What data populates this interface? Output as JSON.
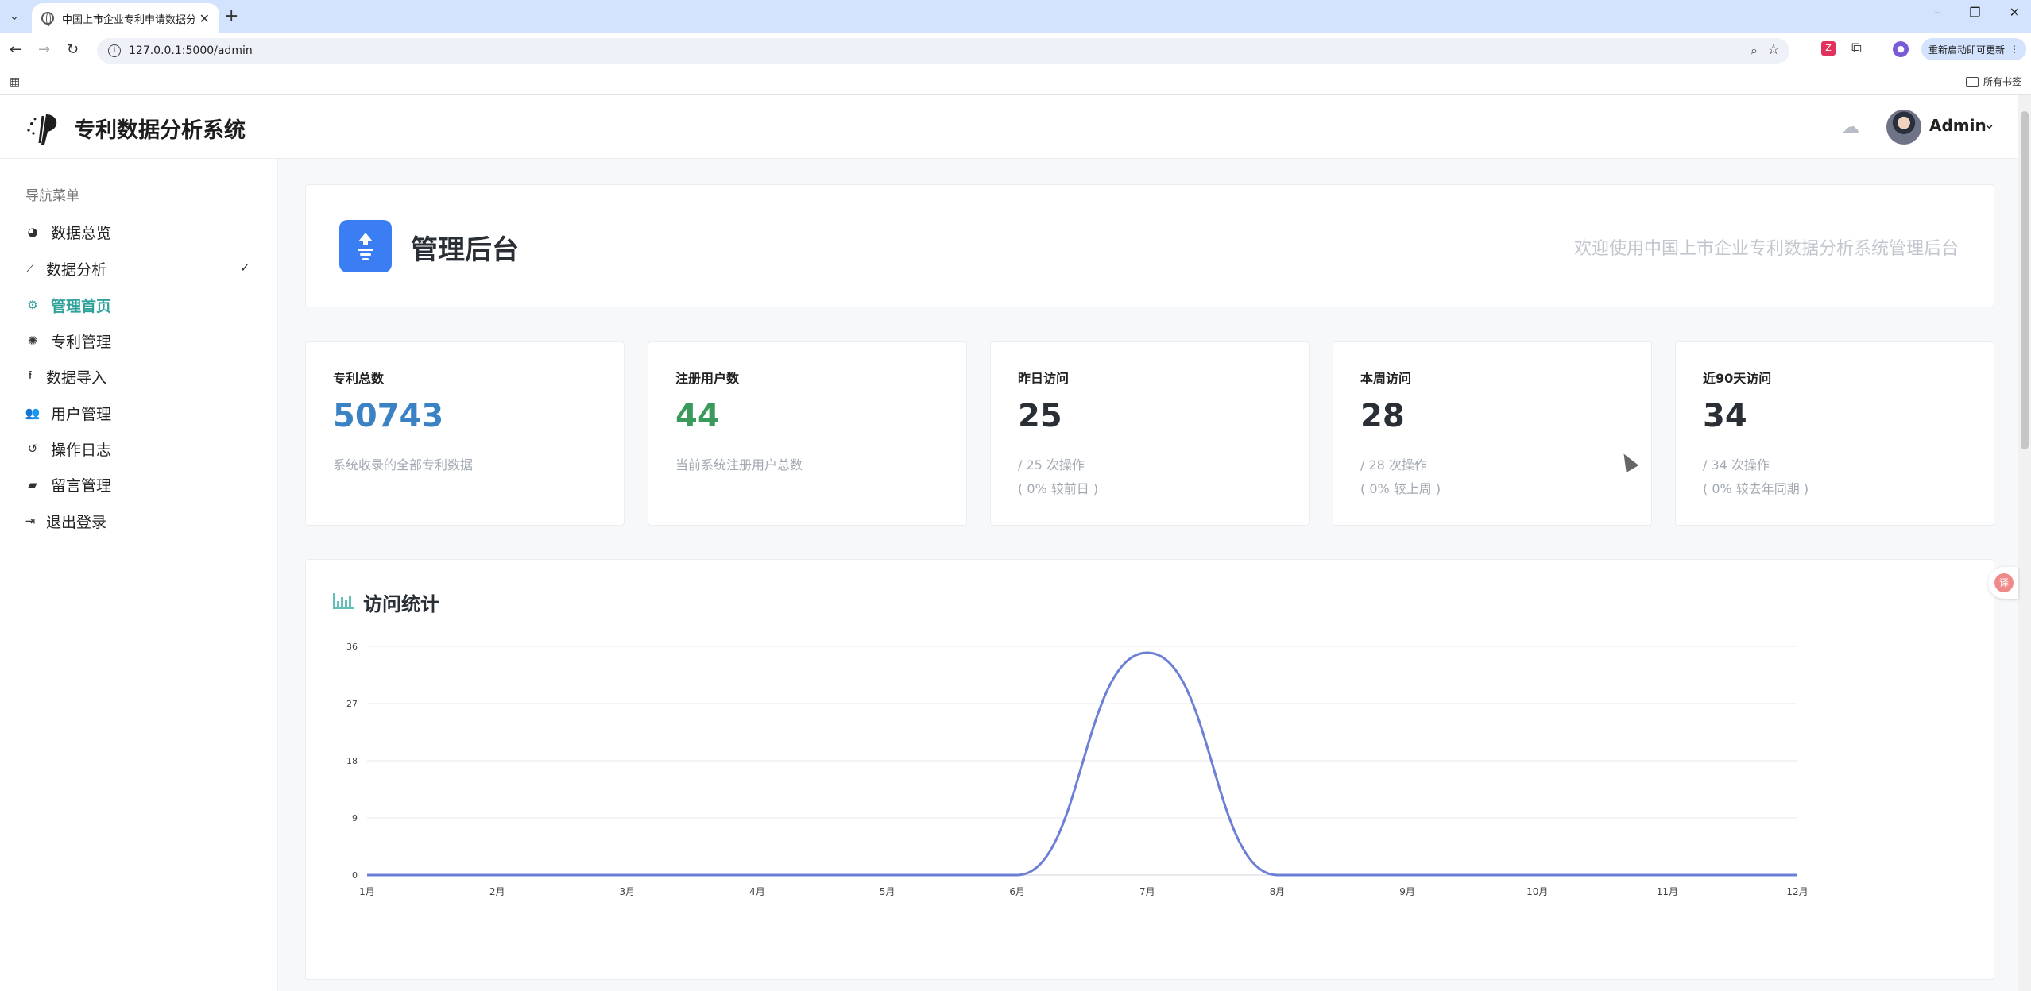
{
  "browser": {
    "tab_title": "中国上市企业专利申请数据分析",
    "url": "127.0.0.1:5000/admin",
    "update_label": "重新启动即可更新",
    "bookmarks_label": "所有书签"
  },
  "header": {
    "brand": "专利数据分析系统",
    "user_name": "Admin"
  },
  "sidebar": {
    "heading": "导航菜单",
    "items": [
      {
        "label": "数据总览",
        "icon": "pie-chart-icon"
      },
      {
        "label": "数据分析",
        "icon": "line-chart-icon"
      },
      {
        "label": "管理首页",
        "icon": "gears-icon"
      },
      {
        "label": "专利管理",
        "icon": "lightbulb-icon"
      },
      {
        "label": "数据导入",
        "icon": "upload-icon"
      },
      {
        "label": "用户管理",
        "icon": "users-icon"
      },
      {
        "label": "操作日志",
        "icon": "history-icon"
      },
      {
        "label": "留言管理",
        "icon": "comments-icon"
      },
      {
        "label": "退出登录",
        "icon": "sign-out-icon"
      }
    ],
    "active_index": 2
  },
  "banner": {
    "title": "管理后台",
    "welcome": "欢迎使用中国上市企业专利数据分析系统管理后台"
  },
  "stats": [
    {
      "label": "专利总数",
      "value": "50743",
      "sub1": "系统收录的全部专利数据",
      "sub2": "",
      "color": "#3a82c4"
    },
    {
      "label": "注册用户数",
      "value": "44",
      "sub1": "当前系统注册用户总数",
      "sub2": "",
      "color": "#3a9a5c"
    },
    {
      "label": "昨日访问",
      "value": "25",
      "sub1": "/ 25 次操作",
      "sub2": "( 0% 较前日 )",
      "color": "#2a2f36"
    },
    {
      "label": "本周访问",
      "value": "28",
      "sub1": "/ 28 次操作",
      "sub2": "( 0% 较上周 )",
      "color": "#2a2f36"
    },
    {
      "label": "近90天访问",
      "value": "34",
      "sub1": "/ 34 次操作",
      "sub2": "( 0% 较去年同期 )",
      "color": "#2a2f36"
    }
  ],
  "chart_title": "访问统计",
  "chart_data": {
    "type": "line",
    "categories": [
      "1月",
      "2月",
      "3月",
      "4月",
      "5月",
      "6月",
      "7月",
      "8月",
      "9月",
      "10月",
      "11月",
      "12月"
    ],
    "series": [
      {
        "values": [
          0,
          0,
          0,
          0,
          0,
          0,
          35,
          0,
          0,
          0,
          0,
          0
        ],
        "color": "#6b7fd7"
      }
    ],
    "yticks": [
      "0",
      "9",
      "18",
      "27",
      "36"
    ],
    "ylim": [
      0,
      36
    ],
    "grid": true,
    "smooth": true
  }
}
